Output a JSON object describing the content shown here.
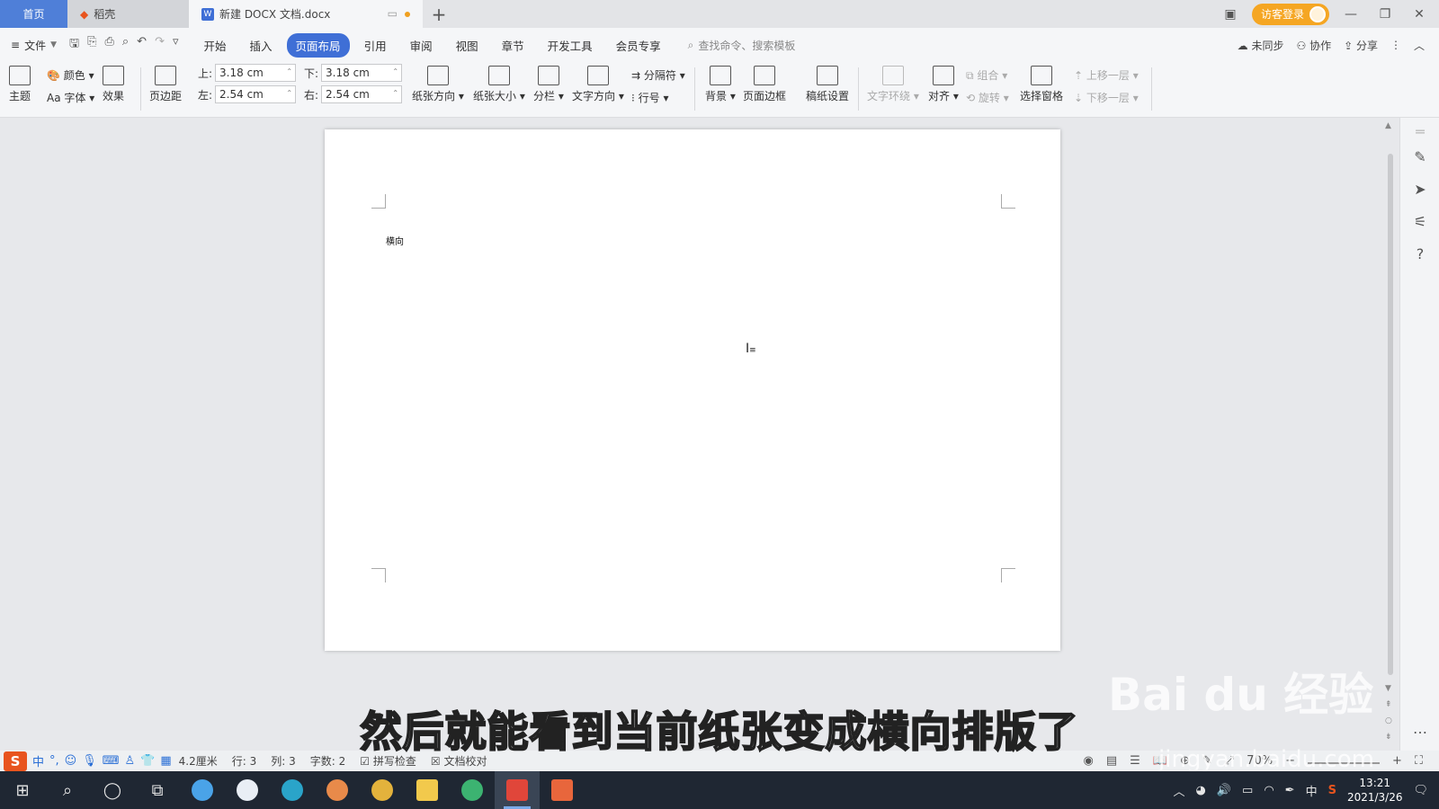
{
  "titlebar": {
    "tab_home": "首页",
    "tab_daoke": "稻壳",
    "tab_doc": "新建 DOCX 文档.docx",
    "tab_add": "+",
    "login": "访客登录"
  },
  "menubar": {
    "file": "文件",
    "tabs": [
      "开始",
      "插入",
      "页面布局",
      "引用",
      "审阅",
      "视图",
      "章节",
      "开发工具",
      "会员专享"
    ],
    "active_tab": "页面布局",
    "search_placeholder": "查找命令、搜索模板",
    "sync": "未同步",
    "collab": "协作",
    "share": "分享"
  },
  "ribbon": {
    "theme": "主题",
    "color": "颜色",
    "font": "字体",
    "effect": "效果",
    "margins": "页边距",
    "margin_top_label": "上:",
    "margin_top": "3.18 cm",
    "margin_bottom_label": "下:",
    "margin_bottom": "3.18 cm",
    "margin_left_label": "左:",
    "margin_left": "2.54 cm",
    "margin_right_label": "右:",
    "margin_right": "2.54 cm",
    "orientation": "纸张方向",
    "size": "纸张大小",
    "columns": "分栏",
    "text_direction": "文字方向",
    "separator": "分隔符",
    "line_number": "行号",
    "background": "背景",
    "page_border": "页面边框",
    "manuscript": "稿纸设置",
    "text_wrap": "文字环绕",
    "align": "对齐",
    "group": "组合",
    "rotate": "旋转",
    "selection_pane": "选择窗格",
    "bring_forward": "上移一层",
    "send_backward": "下移一层"
  },
  "document": {
    "text": "横向"
  },
  "statusbar": {
    "position": "4.2厘米",
    "line": "行: 3",
    "col": "列: 3",
    "wordcount": "字数: 2",
    "spellcheck": "拼写检查",
    "proofread": "文档校对",
    "zoom": "70%"
  },
  "ime": {
    "lang": "中"
  },
  "subtitle": "然后就能看到当前纸张变成横向排版了",
  "watermark": "Bai  du 经验",
  "watermark_url": "jingyan.baidu.com",
  "taskbar": {
    "tray_lang": "中",
    "time": "13:21",
    "date": "2021/3/26"
  },
  "colors": {
    "accent": "#3f6fd6",
    "home_tab": "#4f7fd8",
    "login": "#f5a623",
    "taskbar": "#1f2733"
  }
}
